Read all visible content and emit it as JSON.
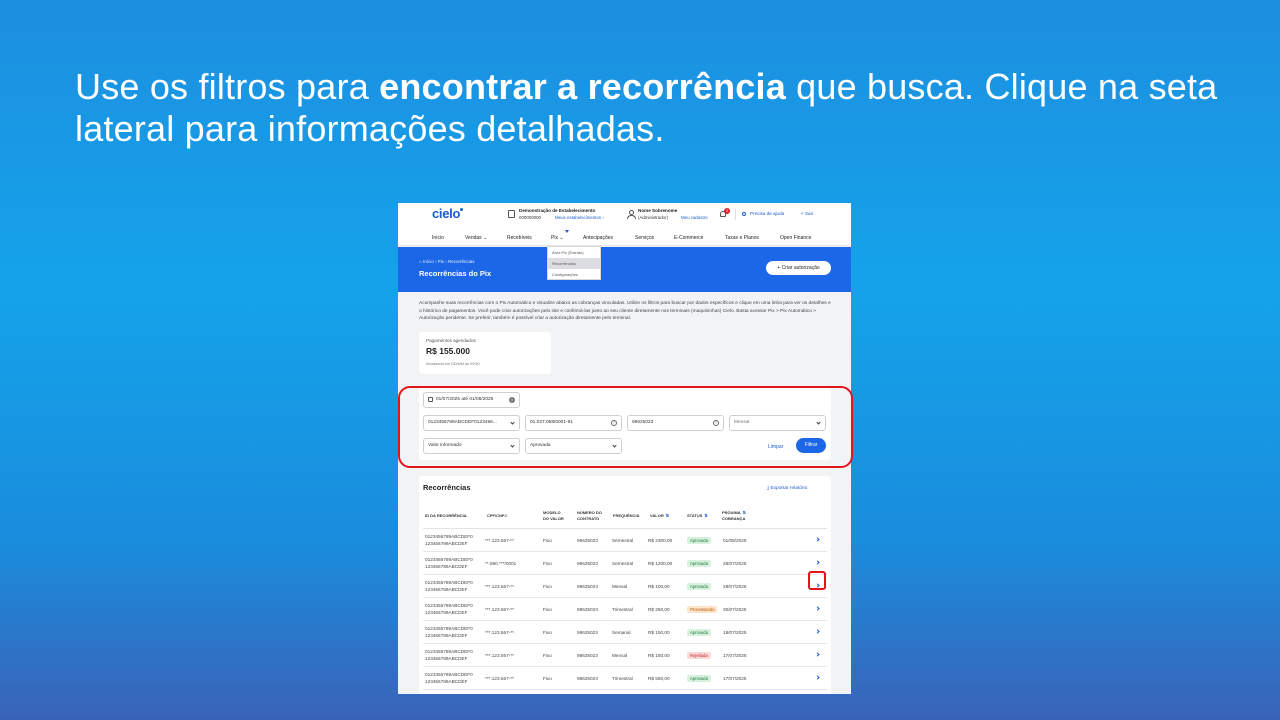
{
  "headline": {
    "part1": "Use os filtros para ",
    "bold": "encontrar a recorrência",
    "part2": " que busca. Clique na seta lateral para informações detalhadas."
  },
  "header": {
    "logo": "cielo",
    "estab_title": "Demonstração de Estabelecimento",
    "estab_number": "000000000",
    "estab_link": "Meus estabelecimentos",
    "user_name": "Nome Sobrenome",
    "user_role": "(Administrador)",
    "user_link": "Meu cadastro",
    "notifications": "2",
    "help": "Precisa de ajuda",
    "exit": "Sair"
  },
  "menu": {
    "items": [
      "Início",
      "Vendas",
      "Recebíveis",
      "Pix",
      "Antecipações",
      "Serviços",
      "E-Commerce",
      "Taxas e Planos",
      "Open Finance"
    ]
  },
  "pix_dropdown": {
    "items": [
      "Área Pix (Extrato)",
      "Recorrências",
      "Configurações"
    ],
    "selected": "Recorrências"
  },
  "hero": {
    "breadcrumb_home": "Início",
    "breadcrumb_pix": "Pix",
    "breadcrumb_current": "Recorrências",
    "title": "Recorrências do Pix",
    "create_button": "+ Criar autorização"
  },
  "description": "Acompanhe suas recorrências com o Pix Automático e visualize abaixo as cobranças vinculadas. Utilize os filtros para buscar por dados específicos e clique em uma linha para ver os detalhes e o histórico de pagamentos. Você pode criar autorizações pelo site e confirmá-las junto ao seu cliente diretamente nos terminais (maquininhas) Cielo. Basta acessar Pix > Pix Automático > Autorização pendente. Se preferir, também é possível criar a autorização diretamente pelo terminal.",
  "scheduled": {
    "label": "Pagamentos agendados",
    "value": "R$ 155.000",
    "updated": "Atualizado em DD/MM às 09:50"
  },
  "filters": {
    "date_range": "01/07/2025 até 01/08/2025",
    "recurrence_id": "0123456789ABCDEF0123456...",
    "cpf_cnpj": "01.027.058/0001-91",
    "contract": "98625023",
    "frequency": "Mensal",
    "value_type": "Valor informado",
    "status": "Aprovada",
    "clear": "Limpar",
    "apply": "Filtrar"
  },
  "list": {
    "title": "Recorrências",
    "export": "Exportar relatório",
    "columns": {
      "id": "ID DA RECORRÊNCIA",
      "cpf": "CPF/CNPJ",
      "modelo1": "MODELO",
      "modelo2": "DO VALOR",
      "numero1": "NÚMERO DO",
      "numero2": "CONTRATO",
      "frequencia": "FREQUÊNCIA",
      "valor": "VALOR",
      "status": "STATUS",
      "proxima1": "PRÓXIMA",
      "proxima2": "COBRANÇA"
    },
    "rows": [
      {
        "id1": "0123456789ABCDEF0",
        "id2": "123456789ABCDEF",
        "cpf": "***.123.567-**",
        "modelo": "Fixo",
        "contrato": "98625023",
        "freq": "Semestral",
        "valor": "R$ 2300,00",
        "status": "Aprovada",
        "status_kind": "green",
        "proxima": "01/08/2025"
      },
      {
        "id1": "0123456789ABCDEF0",
        "id2": "123456789ABCDEF",
        "cpf": "**.590.***/0001",
        "modelo": "Fixo",
        "contrato": "98625023",
        "freq": "Semestral",
        "valor": "R$ 1200,00",
        "status": "Aprovada",
        "status_kind": "green",
        "proxima": "28/07/2025"
      },
      {
        "id1": "0123456789ABCDEF0",
        "id2": "123456789ABCDEF",
        "cpf": "***.123.567-**",
        "modelo": "Fixo",
        "contrato": "98625023",
        "freq": "Mensal",
        "valor": "R$ 100,00",
        "status": "Aprovada",
        "status_kind": "green",
        "proxima": "28/07/2025"
      },
      {
        "id1": "0123456789ABCDEF0",
        "id2": "123456789ABCDEF",
        "cpf": "***.123.567-**",
        "modelo": "Fixo",
        "contrato": "98625023",
        "freq": "Trimestral",
        "valor": "R$ 250,00",
        "status": "Processando",
        "status_kind": "orange",
        "proxima": "30/07/2025"
      },
      {
        "id1": "0123456789ABCDEF0",
        "id2": "123456789ABCDEF",
        "cpf": "***.123.567-**",
        "modelo": "Fixo",
        "contrato": "98625023",
        "freq": "Semanal",
        "valor": "R$ 150,00",
        "status": "Aprovada",
        "status_kind": "green",
        "proxima": "18/07/2025"
      },
      {
        "id1": "0123456789ABCDEF0",
        "id2": "123456789ABCDEF",
        "cpf": "***.123.567-**",
        "modelo": "Fixo",
        "contrato": "98625023",
        "freq": "Mensal",
        "valor": "R$ 150,00",
        "status": "Rejeitada",
        "status_kind": "red",
        "proxima": "17/07/2025"
      },
      {
        "id1": "0123456789ABCDEF0",
        "id2": "123456789ABCDEF",
        "cpf": "***.123.567-**",
        "modelo": "Fixo",
        "contrato": "98625023",
        "freq": "Trimestral",
        "valor": "R$ 550,00",
        "status": "Aprovada",
        "status_kind": "green",
        "proxima": "17/07/2025"
      }
    ]
  },
  "colors": {
    "brand_blue": "#1b67e8",
    "highlight_red": "#e3151c"
  }
}
